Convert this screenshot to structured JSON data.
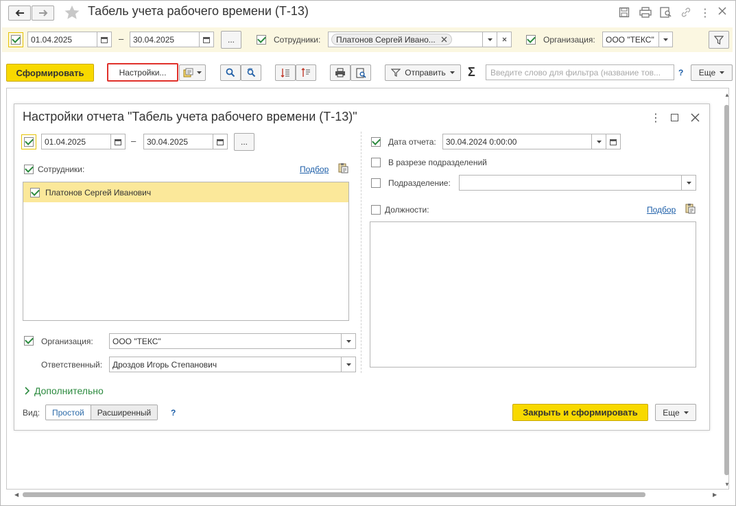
{
  "window": {
    "title": "Табель учета рабочего времени (Т-13)"
  },
  "filter_bar": {
    "period_from": "01.04.2025",
    "dash": "–",
    "period_to": "30.04.2025",
    "more_btn": "...",
    "employees_label": "Сотрудники:",
    "employee_tag": "Платонов Сергей Ивано...",
    "org_label": "Организация:",
    "org_value": "ООО \"ТЕКС\""
  },
  "toolbar": {
    "generate_label": "Сформировать",
    "settings_label": "Настройки...",
    "send_label": "Отправить",
    "sigma": "Σ",
    "filter_placeholder": "Введите слово для фильтра (название тов...",
    "help": "?",
    "more_label": "Еще"
  },
  "dialog": {
    "title": "Настройки отчета \"Табель учета рабочего времени (Т-13)\"",
    "period_from": "01.04.2025",
    "dash": "–",
    "period_to": "30.04.2025",
    "more_btn": "...",
    "employees_label": "Сотрудники:",
    "pick_link": "Подбор",
    "employees": [
      {
        "name": "Платонов Сергей Иванович",
        "checked": true
      }
    ],
    "org_label": "Организация:",
    "org_value": "ООО \"ТЕКС\"",
    "responsible_label": "Ответственный:",
    "responsible_value": "Дроздов Игорь Степанович",
    "report_date_label": "Дата отчета:",
    "report_date_value": "30.04.2024  0:00:00",
    "by_departments_label": "В разрезе подразделений",
    "department_label": "Подразделение:",
    "department_value": "",
    "positions_label": "Должности:",
    "positions_pick_link": "Подбор",
    "additional_label": "Дополнительно",
    "view_label": "Вид:",
    "view_simple": "Простой",
    "view_extended": "Расширенный",
    "help": "?",
    "close_generate_label": "Закрыть и сформировать",
    "more_label": "Еще"
  },
  "colors": {
    "accent_yellow": "#f8d900",
    "filter_bar_bg": "#fbf7e1",
    "check_green": "#2b8a3e",
    "link_blue": "#1c5ea8",
    "highlight_row": "#fbe89a",
    "settings_outline": "#e0302a"
  }
}
